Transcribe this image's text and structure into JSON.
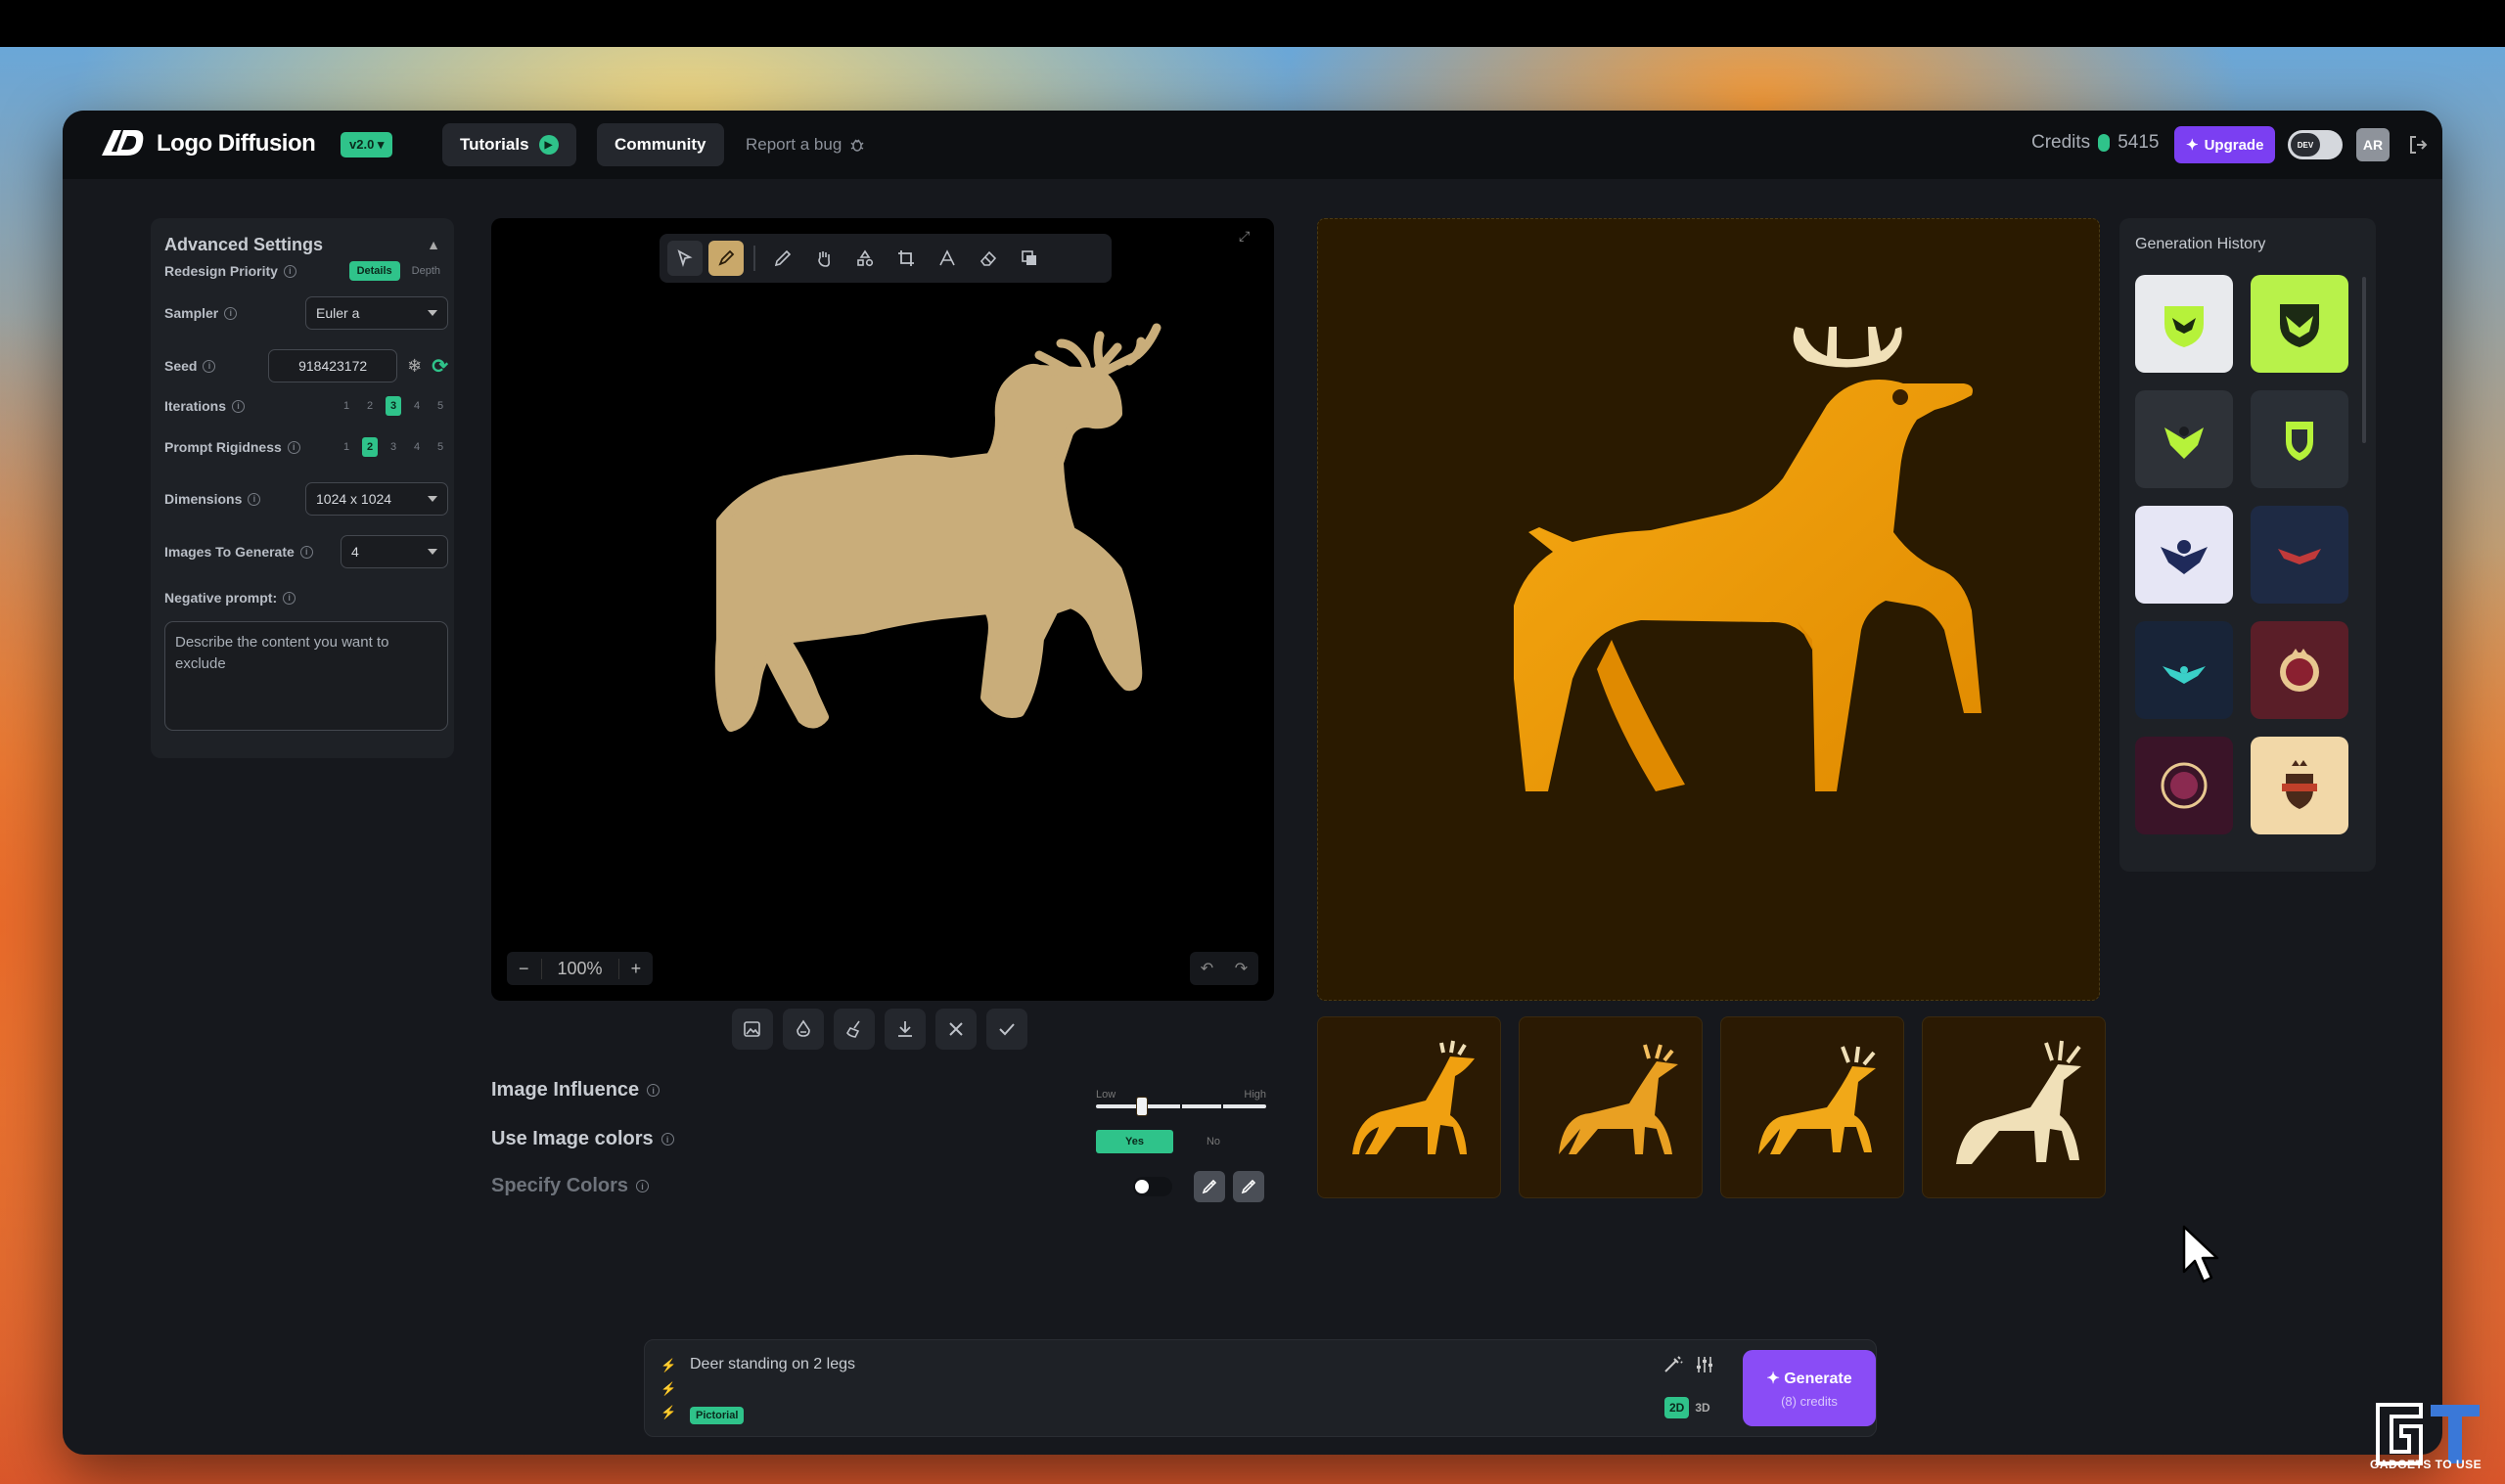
{
  "topbar": {
    "logo_text": "Logo Diffusion",
    "version": "v2.0 ▾",
    "tutorials": "Tutorials",
    "community": "Community",
    "report_bug": "Report a bug",
    "credits_label": "Credits",
    "credits_value": "5415",
    "upgrade": "Upgrade",
    "dev_toggle": "DEV",
    "avatar": "AR"
  },
  "settings": {
    "title": "Advanced Settings",
    "redesign_priority": {
      "label": "Redesign Priority",
      "options": [
        "Details",
        "Depth"
      ],
      "selected": "Details"
    },
    "sampler": {
      "label": "Sampler",
      "value": "Euler a"
    },
    "seed": {
      "label": "Seed",
      "value": "918423172"
    },
    "iterations": {
      "label": "Iterations",
      "options": [
        "1",
        "2",
        "3",
        "4",
        "5"
      ],
      "selected": "3"
    },
    "prompt_rigidness": {
      "label": "Prompt Rigidness",
      "options": [
        "1",
        "2",
        "3",
        "4",
        "5"
      ],
      "selected": "2"
    },
    "dimensions": {
      "label": "Dimensions",
      "value": "1024 x 1024"
    },
    "images_to_generate": {
      "label": "Images To Generate",
      "value": "4"
    },
    "negative_prompt": {
      "label": "Negative prompt:",
      "placeholder": "Describe the content you want to exclude"
    }
  },
  "canvas": {
    "zoom": "100%",
    "zoom_minus": "−",
    "zoom_plus": "+"
  },
  "controls": {
    "image_influence": {
      "label": "Image Influence",
      "low": "Low",
      "high": "High",
      "value_fraction": 0.25
    },
    "use_image_colors": {
      "label": "Use Image colors",
      "yes": "Yes",
      "no": "No",
      "selected": "Yes"
    },
    "specify_colors": {
      "label": "Specify Colors",
      "enabled": false
    }
  },
  "history": {
    "title": "Generation History"
  },
  "prompt": {
    "text": "Deer standing on 2 legs",
    "style_chip": "Pictorial",
    "mode_2d": "2D",
    "mode_3d": "3D",
    "generate_label": "Generate",
    "generate_cost": "(8) credits"
  },
  "watermark": "GADGETS TO USE",
  "colors": {
    "accent_green": "#2fc38a",
    "upgrade_purple": "#7b3ff2",
    "generate_purple": "#8a4cf6",
    "deer_orange": "#f0a010"
  }
}
